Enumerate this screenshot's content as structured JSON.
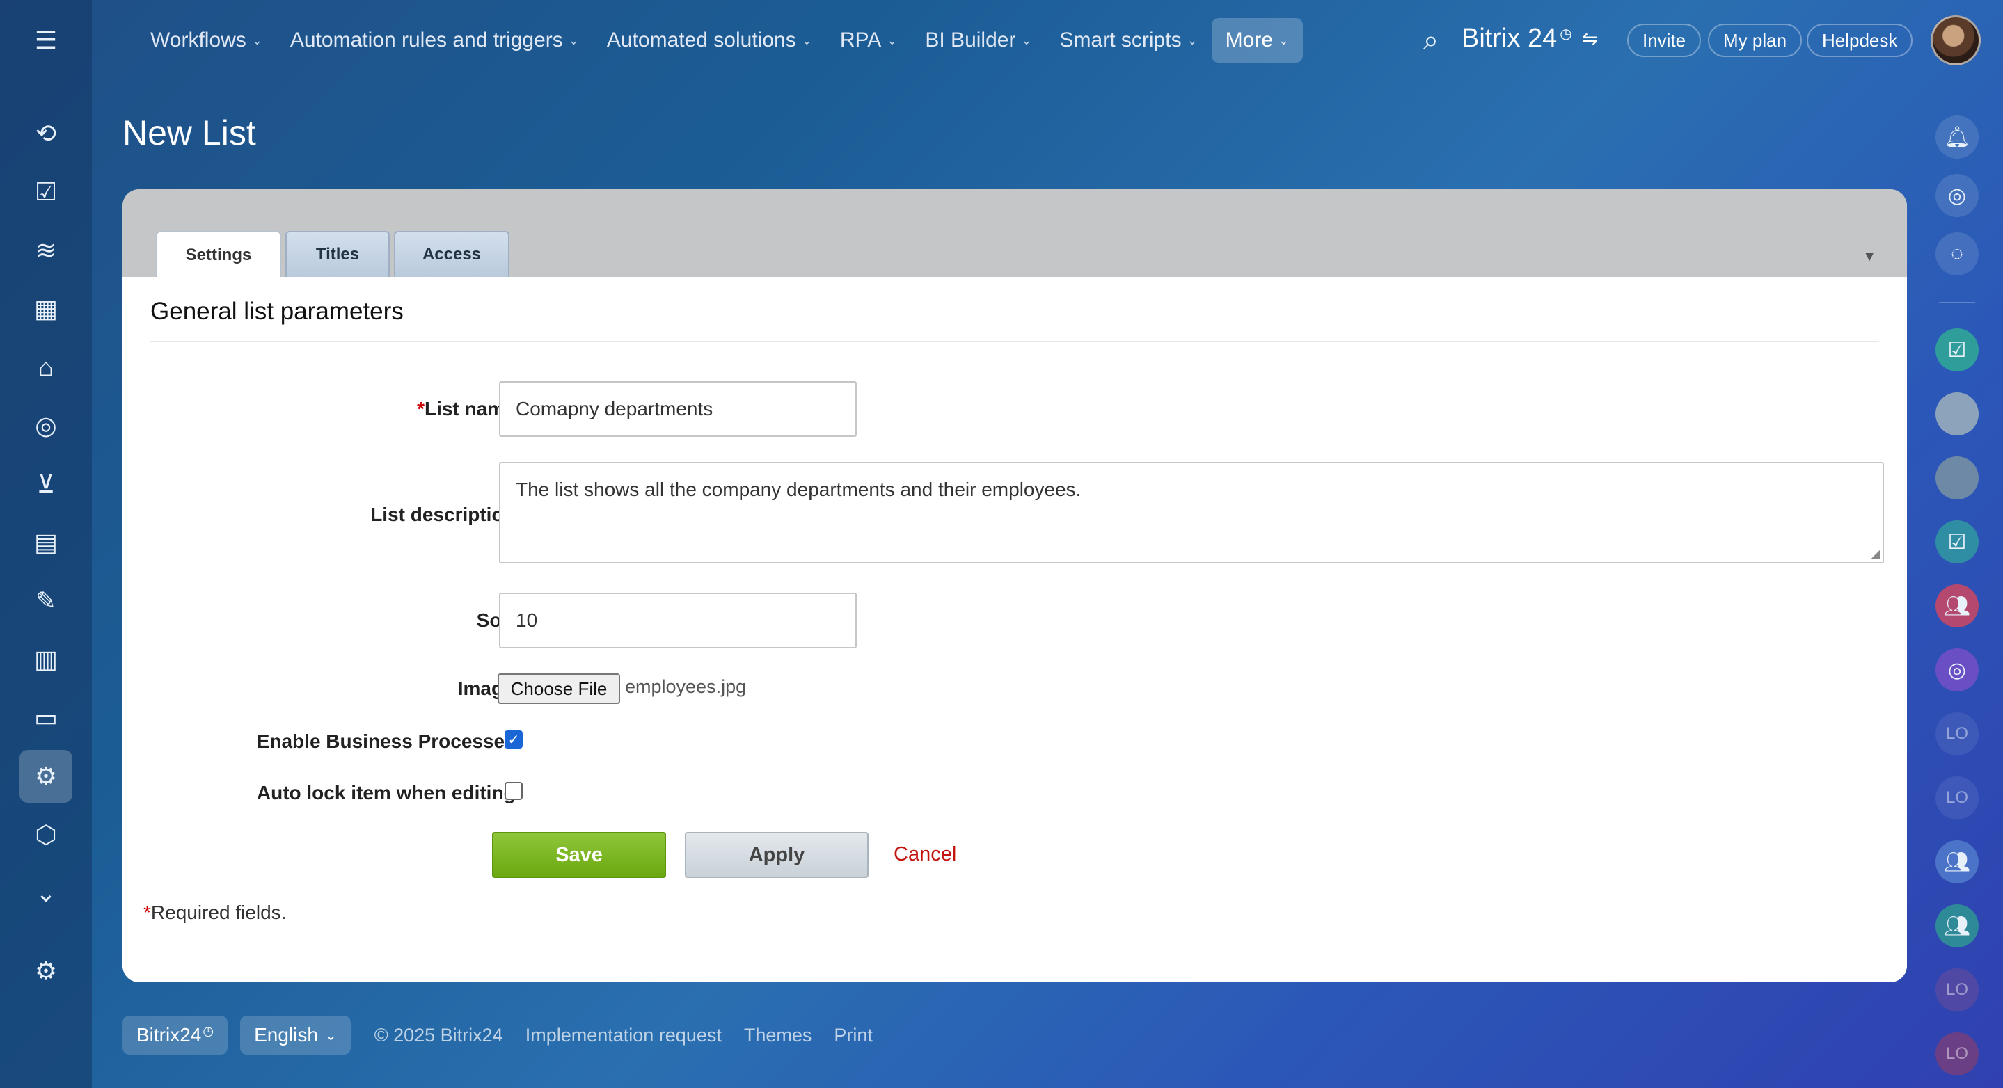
{
  "topnav": {
    "items": [
      {
        "label": "Workflows"
      },
      {
        "label": "Automation rules and triggers"
      },
      {
        "label": "Automated solutions"
      },
      {
        "label": "RPA"
      },
      {
        "label": "BI Builder"
      },
      {
        "label": "Smart scripts"
      }
    ],
    "more_label": "More",
    "brand": "Bitrix 24",
    "invite": "Invite",
    "my_plan": "My plan",
    "helpdesk": "Helpdesk"
  },
  "right_rail": {
    "lo_label": "LO"
  },
  "page": {
    "title": "New List"
  },
  "tabs": [
    {
      "label": "Settings"
    },
    {
      "label": "Titles"
    },
    {
      "label": "Access"
    }
  ],
  "form": {
    "section_title": "General list parameters",
    "required_mark": "*",
    "list_name_label": "List name:",
    "list_name_value": "Comapny departments",
    "description_label": "List description:",
    "description_value": "The list shows all the company departments and their employees.",
    "sort_label": "Sort:",
    "sort_value": "10",
    "image_label": "Image:",
    "choose_file_label": "Choose File",
    "file_name": "employees.jpg",
    "enable_bp_label": "Enable Business Processes:",
    "enable_bp_checked": true,
    "auto_lock_label": "Auto lock item when editing:",
    "auto_lock_checked": false,
    "save_label": "Save",
    "apply_label": "Apply",
    "cancel_label": "Cancel",
    "required_note": "Required fields."
  },
  "footer": {
    "brand": "Bitrix24",
    "language": "English",
    "copyright": "© 2025 Bitrix24",
    "links": [
      "Implementation request",
      "Themes",
      "Print"
    ]
  }
}
